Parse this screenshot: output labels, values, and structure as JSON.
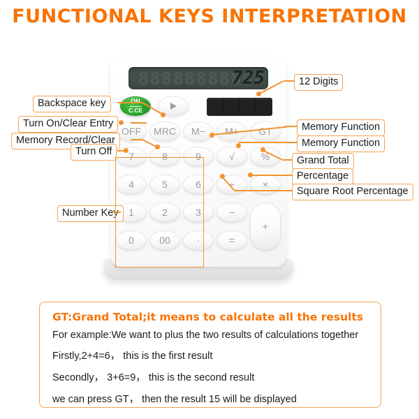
{
  "title": "FUNCTIONAL KEYS INTERPRETATION",
  "colors": {
    "accent": "#F97304",
    "leader": "#F4922F",
    "label_border": "#F2A355",
    "on_key": "#2aa62a",
    "background": "#FFFFFF"
  },
  "callouts": {
    "left": [
      {
        "id": "backspace",
        "label": "Backspace key"
      },
      {
        "id": "turn-on-clear-entry",
        "label": "Turn On/Clear Entry"
      },
      {
        "id": "memory-record-clear",
        "label": "Memory Record/Clear"
      },
      {
        "id": "turn-off",
        "label": "Turn Off"
      },
      {
        "id": "number-key",
        "label": "Number Key"
      }
    ],
    "right": [
      {
        "id": "twelve-digits",
        "label": "12 Digits"
      },
      {
        "id": "memory-function-1",
        "label": "Memory Function"
      },
      {
        "id": "memory-function-2",
        "label": "Memory Function"
      },
      {
        "id": "grand-total",
        "label": "Grand Total"
      },
      {
        "id": "percentage",
        "label": "Percentage"
      },
      {
        "id": "square-root-percentage",
        "label": "Square Root Percentage"
      }
    ]
  },
  "calculator": {
    "display": {
      "ghost_digits": "88888888888",
      "value": "725",
      "digit_capacity": "12 Digits"
    },
    "solar_panel": "solar-panel",
    "keys": {
      "row_function": [
        {
          "id": "on-ce",
          "top": "ON",
          "bottom": "C.CE"
        },
        {
          "id": "backspace",
          "label": "▶"
        }
      ],
      "row_memory": [
        {
          "id": "off",
          "label": "OFF"
        },
        {
          "id": "mrc",
          "label": "MRC"
        },
        {
          "id": "m-minus",
          "label": "M−"
        },
        {
          "id": "m-plus",
          "label": "M+"
        },
        {
          "id": "gt",
          "label": "GT"
        }
      ],
      "numbers": [
        {
          "id": "7",
          "label": "7"
        },
        {
          "id": "8",
          "label": "8"
        },
        {
          "id": "9",
          "label": "9"
        },
        {
          "id": "4",
          "label": "4"
        },
        {
          "id": "5",
          "label": "5"
        },
        {
          "id": "6",
          "label": "6"
        },
        {
          "id": "1",
          "label": "1"
        },
        {
          "id": "2",
          "label": "2"
        },
        {
          "id": "3",
          "label": "3"
        },
        {
          "id": "0",
          "label": "0"
        },
        {
          "id": "00",
          "label": "00"
        },
        {
          "id": "dot",
          "label": "·"
        }
      ],
      "operators": [
        {
          "id": "sqrt",
          "label": "√"
        },
        {
          "id": "percent",
          "label": "%"
        },
        {
          "id": "divide",
          "label": "÷"
        },
        {
          "id": "multiply",
          "label": "×"
        },
        {
          "id": "minus",
          "label": "−"
        },
        {
          "id": "equals",
          "label": "="
        },
        {
          "id": "plus",
          "label": "+"
        }
      ]
    }
  },
  "note": {
    "title": "GT:Grand Total;it means to calculate all the results",
    "lines": [
      "For example:We want to plus the two  results of calculations together",
      "Firstly,2+4=6， this is the first result",
      "Secondly， 3+6=9， this is the second result",
      "we can press GT， then the result 15 will be displayed"
    ]
  }
}
